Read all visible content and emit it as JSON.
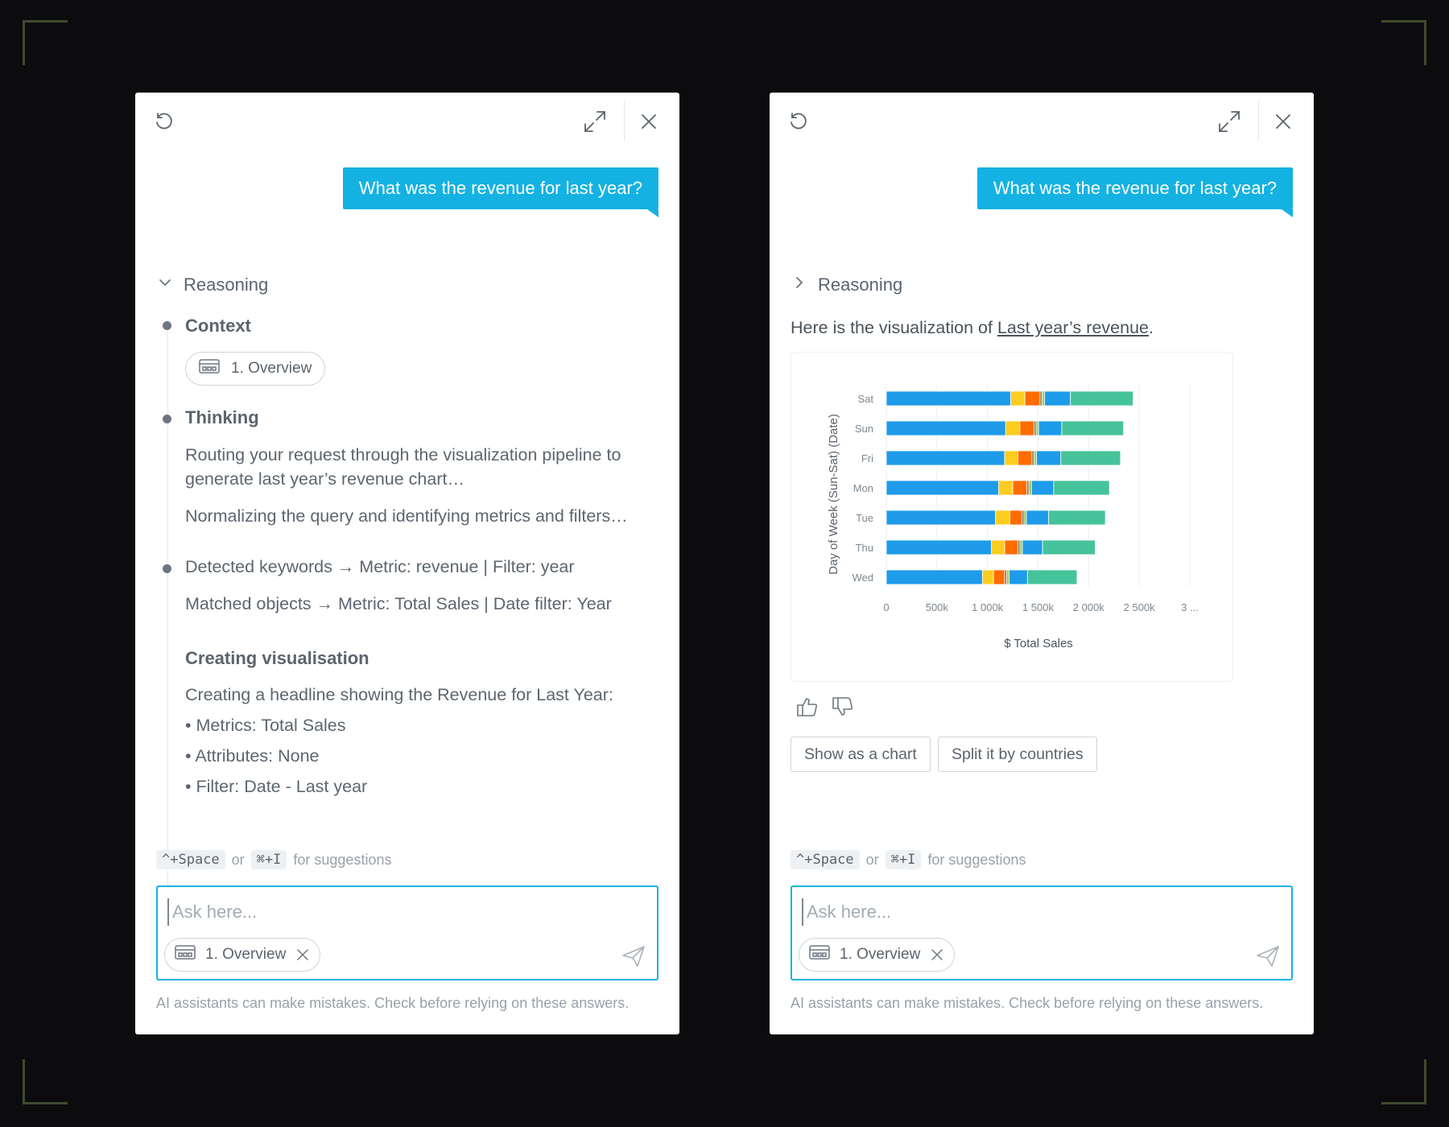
{
  "user_question": "What was the revenue for last year?",
  "reasoning_label": "Reasoning",
  "context": {
    "title": "Context",
    "chip_label": "1. Overview"
  },
  "thinking": {
    "title": "Thinking",
    "paragraphs": [
      "Routing your request through the visualization pipeline to generate last year’s revenue chart…",
      "Normalizing the query and identifying metrics and filters…"
    ],
    "detected": "Detected keywords → Metric: revenue | Filter: year",
    "matched": "Matched objects → Metric: Total Sales | Date filter: Year"
  },
  "creating": {
    "title": "Creating visualisation",
    "intro": "Creating a headline showing the Revenue for Last Year:",
    "bullets": [
      "• Metrics: Total Sales",
      "• Attributes: None",
      "• Filter: Date - Last year"
    ]
  },
  "hint": {
    "key1": "^+Space",
    "or": "or",
    "key2": "⌘+I",
    "suffix": "for suggestions"
  },
  "input": {
    "placeholder": "Ask here...",
    "chip_label": "1. Overview"
  },
  "disclaimer": "AI assistants can make mistakes. Check before relying on these answers.",
  "answer": {
    "prefix": "Here is the visualization of ",
    "link": "Last year’s revenue",
    "suffix": "."
  },
  "suggestions": [
    "Show as a chart",
    "Split it by countries"
  ],
  "icons": {
    "reset": "reset-icon",
    "expand": "expand-icon",
    "close": "close-icon",
    "chevron_down": "chevron-down-icon",
    "chevron_right": "chevron-right-icon",
    "insight": "insight-icon",
    "send": "send-icon",
    "thumbs_up": "thumbs-up-icon",
    "thumbs_down": "thumbs-down-icon"
  },
  "colors": {
    "accent": "#14b2e2",
    "series": [
      "#1e9be9",
      "#fccd1f",
      "#ff6c00",
      "#9c6a3e",
      "#9aca59",
      "#1e9be9",
      "#45c39a"
    ]
  },
  "chart_data": {
    "type": "bar",
    "orientation": "horizontal",
    "stacked": true,
    "categories": [
      "Sat",
      "Sun",
      "Fri",
      "Mon",
      "Tue",
      "Thu",
      "Wed"
    ],
    "series": [
      {
        "values": [
          1230,
          1180,
          1170,
          1110,
          1080,
          1040,
          950
        ]
      },
      {
        "values": [
          140,
          140,
          130,
          140,
          140,
          130,
          110
        ]
      },
      {
        "values": [
          150,
          140,
          140,
          140,
          120,
          130,
          110
        ]
      },
      {
        "values": [
          20,
          20,
          20,
          20,
          20,
          20,
          20
        ]
      },
      {
        "values": [
          25,
          25,
          25,
          25,
          25,
          25,
          25
        ]
      },
      {
        "values": [
          255,
          230,
          240,
          220,
          220,
          200,
          180
        ]
      },
      {
        "values": [
          620,
          610,
          590,
          550,
          560,
          520,
          490
        ]
      }
    ],
    "xlabel": "$ Total Sales",
    "ylabel": "Day of Week (Sun-Sat) (Date)",
    "x_ticks": [
      "0",
      "500k",
      "1 000k",
      "1 500k",
      "2 000k",
      "2 500k",
      "3 ..."
    ],
    "x_tick_values": [
      0,
      500,
      1000,
      1500,
      2000,
      2500,
      3000
    ],
    "xlim": [
      0,
      3000
    ],
    "grid": true,
    "legend": "none"
  }
}
